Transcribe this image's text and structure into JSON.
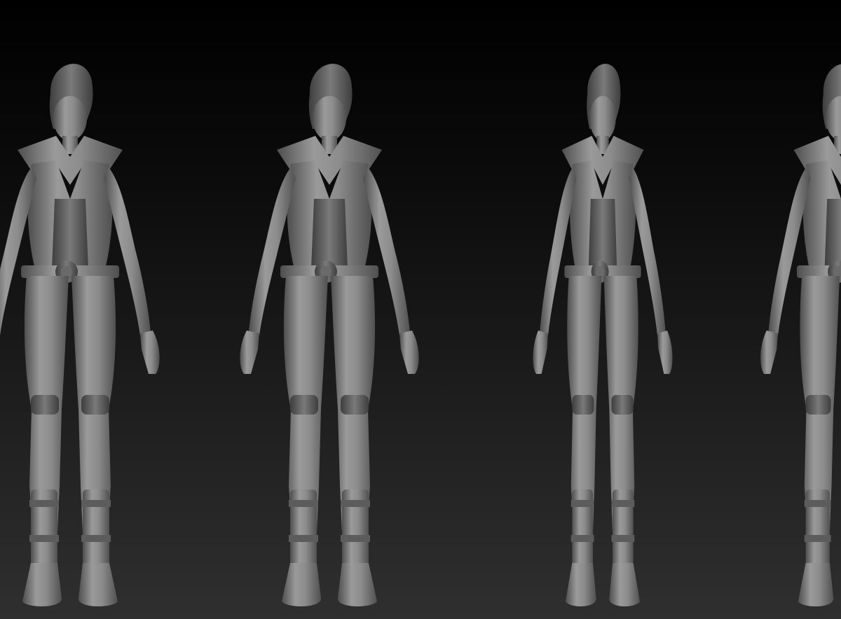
{
  "scene": {
    "background_top": "#000000",
    "background_bottom": "#2f2f2f",
    "material_color": "#8a8a8a",
    "material_shadow": "#4a4a4a",
    "material_highlight": "#b8b8b8",
    "views": [
      {
        "name": "front-three-quarter"
      },
      {
        "name": "front"
      },
      {
        "name": "side"
      },
      {
        "name": "back-three-quarter"
      }
    ]
  }
}
